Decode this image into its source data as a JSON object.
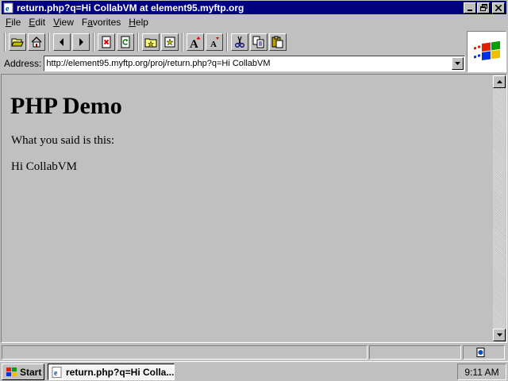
{
  "window": {
    "title": "return.php?q=Hi CollabVM at element95.myftp.org",
    "controls": {
      "minimize": "_",
      "maximize": "❐",
      "close": "✕"
    }
  },
  "menu": [
    {
      "label": "File",
      "accesskey": "F",
      "rest": "ile"
    },
    {
      "label": "Edit",
      "accesskey": "E",
      "rest": "dit"
    },
    {
      "label": "View",
      "accesskey": "V",
      "rest": "iew"
    },
    {
      "label": "Favorites",
      "accesskey": "a",
      "pre": "F",
      "rest": "vorites"
    },
    {
      "label": "Help",
      "accesskey": "H",
      "rest": "elp"
    }
  ],
  "toolbar": {
    "buttons": [
      "open-icon",
      "home-icon",
      "back-icon",
      "forward-icon",
      "stop-icon",
      "refresh-icon",
      "open-start-page-icon",
      "favorites-icon",
      "larger-font-icon",
      "smaller-font-icon",
      "cut-icon",
      "copy-icon",
      "paste-icon"
    ]
  },
  "address": {
    "label": "Address:",
    "url": "http://element95.myftp.org/proj/return.php?q=Hi CollabVM"
  },
  "page": {
    "heading": "PHP Demo",
    "line1": "What you said is this:",
    "line2": "Hi CollabVM"
  },
  "taskbar": {
    "start_label": "Start",
    "task_label": "return.php?q=Hi Colla...",
    "clock": "9:11 AM"
  },
  "colors": {
    "titlebar": "#000080",
    "chrome": "#c0c0c0",
    "page_background": "#c0c0c0"
  }
}
